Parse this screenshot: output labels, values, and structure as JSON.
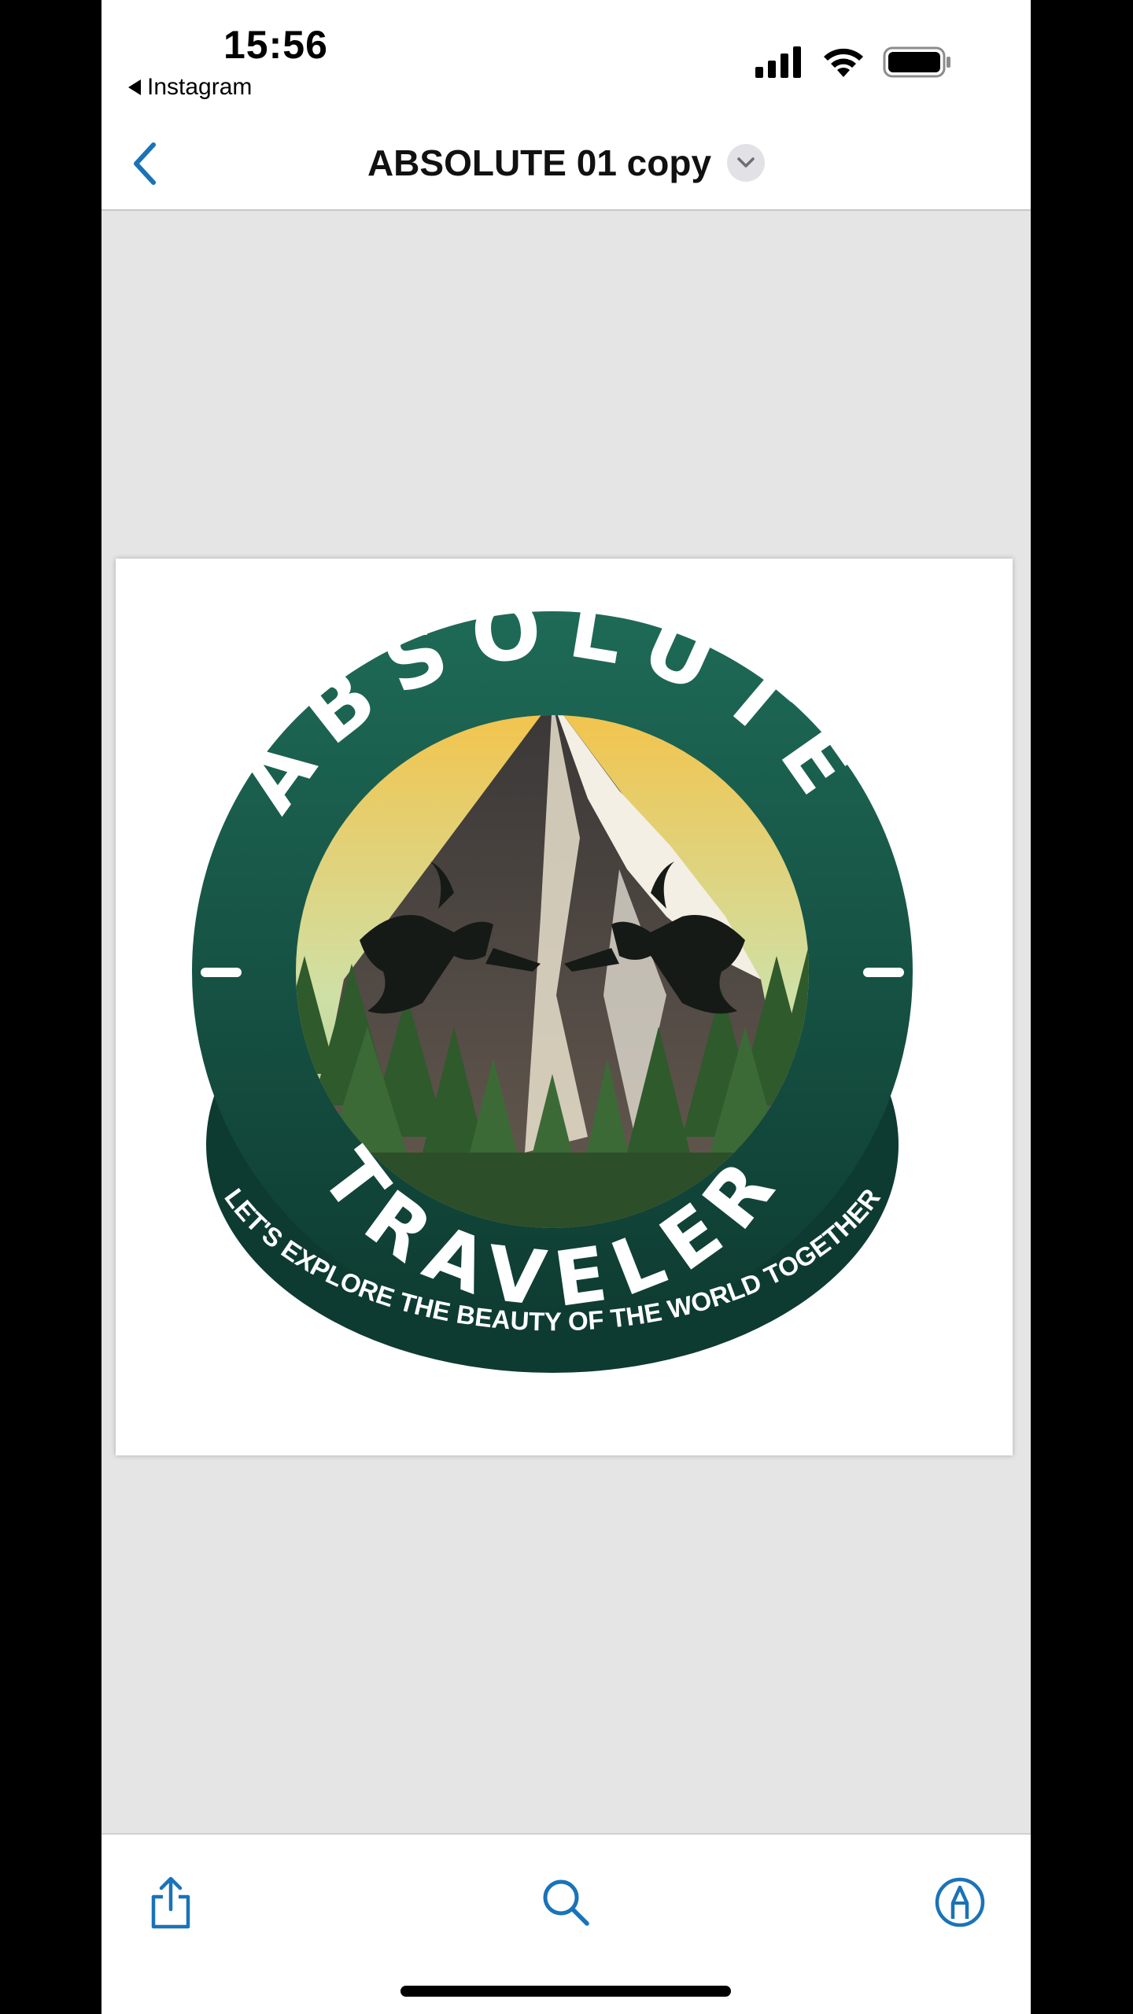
{
  "status_bar": {
    "time": "15:56",
    "back_app_label": "Instagram"
  },
  "nav": {
    "title": "ABSOLUTE 01 copy"
  },
  "image": {
    "logo_top_text": "ABSOLUTE",
    "logo_middle_text": "TRAVELER",
    "logo_tagline": "LET'S EXPLORE THE BEAUTY OF THE WORLD TOGETHER"
  },
  "toolbar": {
    "share_icon": "share-icon",
    "search_icon": "search-icon",
    "markup_icon": "markup-icon"
  },
  "colors": {
    "accent": "#1a73b8",
    "logo_dark_green": "#0f3f33",
    "logo_mid_green": "#1e6a57",
    "sky_top": "#f2c44e",
    "sky_bottom": "#cfe0a6"
  }
}
